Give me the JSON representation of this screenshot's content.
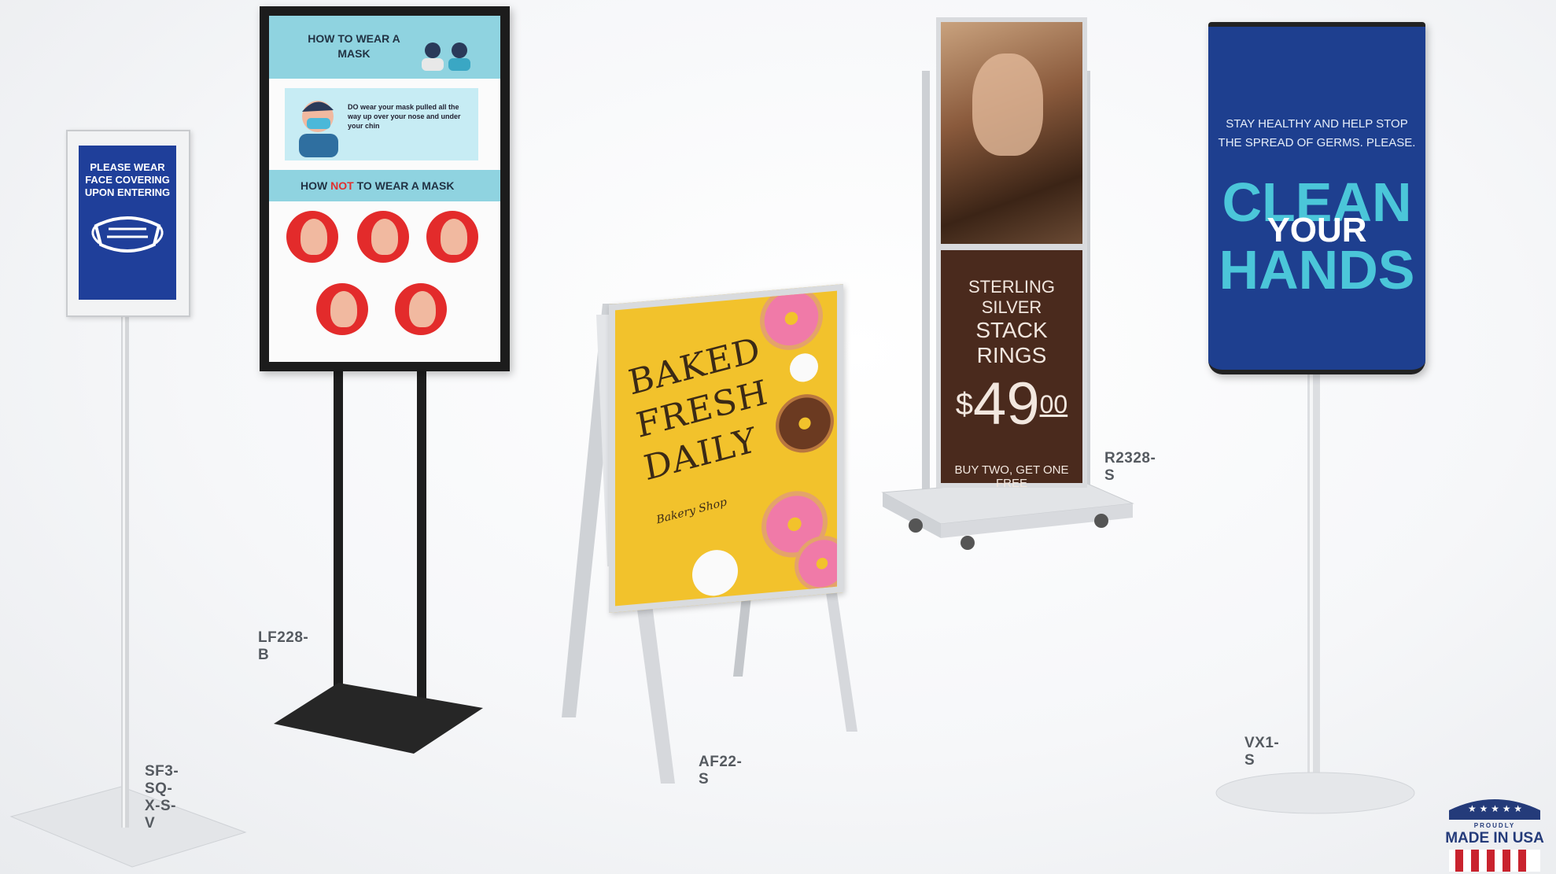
{
  "products": {
    "sf3": {
      "model": "SF3-SQ-X-S-V",
      "sign_text": "PLEASE WEAR FACE COVERING UPON ENTERING"
    },
    "lf228": {
      "model": "LF228-B",
      "poster_title": "HOW TO WEAR A MASK",
      "do_text": "DO wear your mask pulled all the way up over your nose and under your chin",
      "dont_heading_pre": "HOW",
      "dont_heading_not": "NOT",
      "dont_heading_post": "TO WEAR A MASK"
    },
    "af22": {
      "model": "AF22-S",
      "sign_line1": "BAKED",
      "sign_line2": "FRESH",
      "sign_line3": "DAILY",
      "logo_text": "Bakery Shop"
    },
    "r2328": {
      "model": "R2328-S",
      "line1": "STERLING SILVER",
      "line2": "STACK RINGS",
      "price_dollar": "$",
      "price_main": "49",
      "price_cents": "00",
      "line3": "BUY TWO, GET ONE FREE"
    },
    "vx1": {
      "model": "VX1-S",
      "line1": "STAY HEALTHY AND HELP STOP",
      "line2": "THE SPREAD OF GERMS. PLEASE.",
      "word1": "CLEAN",
      "word2": "YOUR",
      "word3": "HANDS"
    }
  },
  "badge": {
    "top": "PROUDLY",
    "main": "MADE IN USA"
  },
  "colors": {
    "label": "#555a60",
    "navy": "#1f3f9a",
    "teal": "#4bc6d9",
    "yellow": "#f2c22c",
    "brown": "#4a2a1d"
  }
}
